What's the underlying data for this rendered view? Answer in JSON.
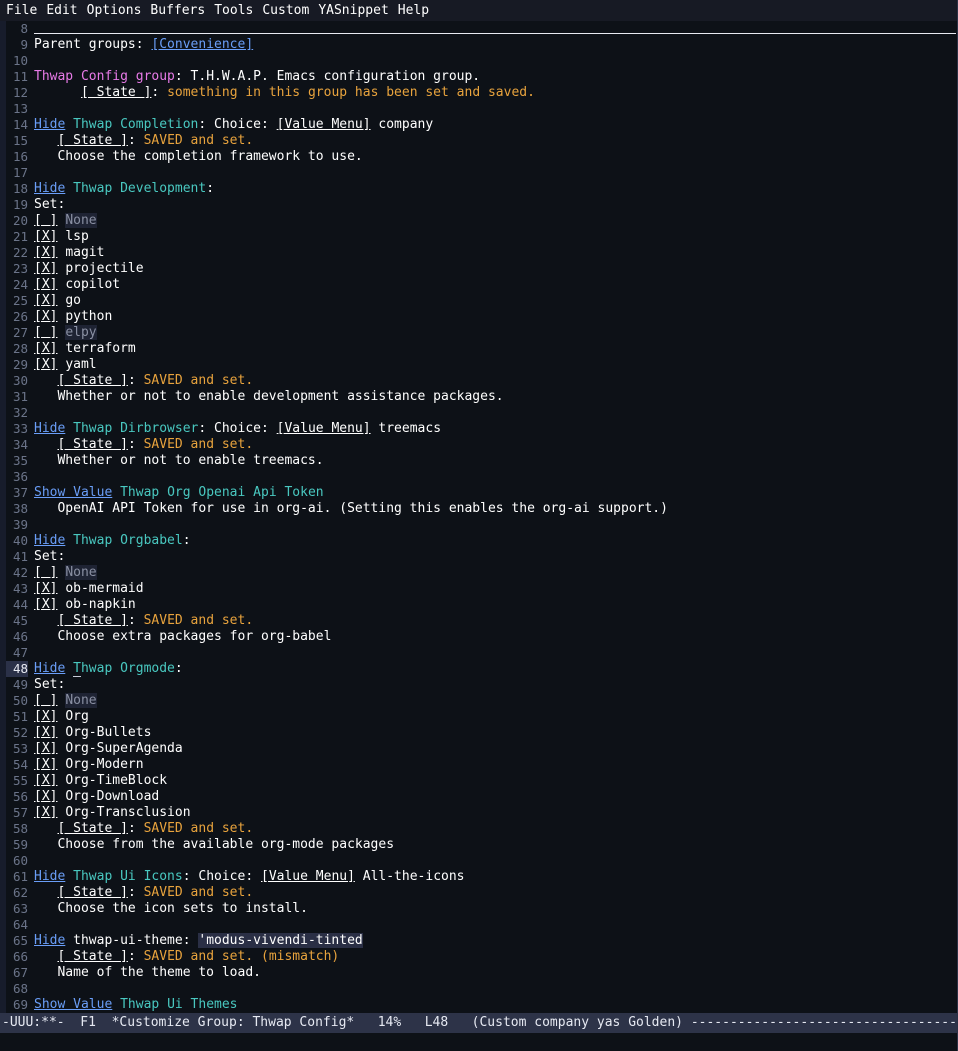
{
  "menubar": {
    "items": [
      "File",
      "Edit",
      "Options",
      "Buffers",
      "Tools",
      "Custom",
      "YASnippet",
      "Help"
    ]
  },
  "buffer": {
    "first_line_number": 8,
    "current_line_number": 48,
    "lines": [
      {
        "n": 8,
        "kind": "rule",
        "text": ""
      },
      {
        "n": 9,
        "kind": "parent",
        "label": "Parent groups: ",
        "link": "[Convenience]"
      },
      {
        "n": 10,
        "kind": "blank",
        "text": ""
      },
      {
        "n": 11,
        "kind": "grouphead",
        "group": "Thwap Config group",
        "sep": ": ",
        "desc": "T.H.W.A.P. Emacs configuration group."
      },
      {
        "n": 12,
        "kind": "state",
        "indent": "      ",
        "button": "[ State ]",
        "sep": ": ",
        "status": "something in this group has been set and saved."
      },
      {
        "n": 13,
        "kind": "blank",
        "text": ""
      },
      {
        "n": 14,
        "kind": "choice",
        "toggle": "Hide",
        "var": "Thwap Completion",
        "sep": ": Choice: ",
        "menu": "[Value Menu]",
        "value": " company"
      },
      {
        "n": 15,
        "kind": "state",
        "indent": "   ",
        "button": "[ State ]",
        "sep": ": ",
        "status": "SAVED and set."
      },
      {
        "n": 16,
        "kind": "doc",
        "text": "   Choose the completion framework to use."
      },
      {
        "n": 17,
        "kind": "blank",
        "text": ""
      },
      {
        "n": 18,
        "kind": "choice",
        "toggle": "Hide",
        "var": "Thwap Development",
        "sep": ":",
        "menu": "",
        "value": ""
      },
      {
        "n": 19,
        "kind": "doc",
        "text": "Set:"
      },
      {
        "n": 20,
        "kind": "check",
        "box": "[ ]",
        "label": "None",
        "on": false
      },
      {
        "n": 21,
        "kind": "check",
        "box": "[X]",
        "label": "lsp",
        "on": true
      },
      {
        "n": 22,
        "kind": "check",
        "box": "[X]",
        "label": "magit",
        "on": true
      },
      {
        "n": 23,
        "kind": "check",
        "box": "[X]",
        "label": "projectile",
        "on": true
      },
      {
        "n": 24,
        "kind": "check",
        "box": "[X]",
        "label": "copilot",
        "on": true
      },
      {
        "n": 25,
        "kind": "check",
        "box": "[X]",
        "label": "go",
        "on": true
      },
      {
        "n": 26,
        "kind": "check",
        "box": "[X]",
        "label": "python",
        "on": true
      },
      {
        "n": 27,
        "kind": "check",
        "box": "[ ]",
        "label": "elpy",
        "on": false
      },
      {
        "n": 28,
        "kind": "check",
        "box": "[X]",
        "label": "terraform",
        "on": true
      },
      {
        "n": 29,
        "kind": "check",
        "box": "[X]",
        "label": "yaml",
        "on": true
      },
      {
        "n": 30,
        "kind": "state",
        "indent": "   ",
        "button": "[ State ]",
        "sep": ": ",
        "status": "SAVED and set."
      },
      {
        "n": 31,
        "kind": "doc",
        "text": "   Whether or not to enable development assistance packages."
      },
      {
        "n": 32,
        "kind": "blank",
        "text": ""
      },
      {
        "n": 33,
        "kind": "choice",
        "toggle": "Hide",
        "var": "Thwap Dirbrowser",
        "sep": ": Choice: ",
        "menu": "[Value Menu]",
        "value": " treemacs"
      },
      {
        "n": 34,
        "kind": "state",
        "indent": "   ",
        "button": "[ State ]",
        "sep": ": ",
        "status": "SAVED and set."
      },
      {
        "n": 35,
        "kind": "doc",
        "text": "   Whether or not to enable treemacs."
      },
      {
        "n": 36,
        "kind": "blank",
        "text": ""
      },
      {
        "n": 37,
        "kind": "choice",
        "toggle": "Show Value",
        "var": "Thwap Org Openai Api Token",
        "sep": "",
        "menu": "",
        "value": ""
      },
      {
        "n": 38,
        "kind": "doc",
        "text": "   OpenAI API Token for use in org-ai. (Setting this enables the org-ai support.)"
      },
      {
        "n": 39,
        "kind": "blank",
        "text": ""
      },
      {
        "n": 40,
        "kind": "choice",
        "toggle": "Hide",
        "var": "Thwap Orgbabel",
        "sep": ":",
        "menu": "",
        "value": ""
      },
      {
        "n": 41,
        "kind": "doc",
        "text": "Set:"
      },
      {
        "n": 42,
        "kind": "check",
        "box": "[ ]",
        "label": "None",
        "on": false
      },
      {
        "n": 43,
        "kind": "check",
        "box": "[X]",
        "label": "ob-mermaid",
        "on": true
      },
      {
        "n": 44,
        "kind": "check",
        "box": "[X]",
        "label": "ob-napkin",
        "on": true
      },
      {
        "n": 45,
        "kind": "state",
        "indent": "   ",
        "button": "[ State ]",
        "sep": ": ",
        "status": "SAVED and set."
      },
      {
        "n": 46,
        "kind": "doc",
        "text": "   Choose extra packages for org-babel"
      },
      {
        "n": 47,
        "kind": "blank",
        "text": ""
      },
      {
        "n": 48,
        "kind": "choice",
        "toggle": "Hide",
        "var": "Thwap Orgmode",
        "sep": ":",
        "menu": "",
        "value": "",
        "cursor": true
      },
      {
        "n": 49,
        "kind": "doc",
        "text": "Set:"
      },
      {
        "n": 50,
        "kind": "check",
        "box": "[ ]",
        "label": "None",
        "on": false
      },
      {
        "n": 51,
        "kind": "check",
        "box": "[X]",
        "label": "Org",
        "on": true
      },
      {
        "n": 52,
        "kind": "check",
        "box": "[X]",
        "label": "Org-Bullets",
        "on": true
      },
      {
        "n": 53,
        "kind": "check",
        "box": "[X]",
        "label": "Org-SuperAgenda",
        "on": true
      },
      {
        "n": 54,
        "kind": "check",
        "box": "[X]",
        "label": "Org-Modern",
        "on": true
      },
      {
        "n": 55,
        "kind": "check",
        "box": "[X]",
        "label": "Org-TimeBlock",
        "on": true
      },
      {
        "n": 56,
        "kind": "check",
        "box": "[X]",
        "label": "Org-Download",
        "on": true
      },
      {
        "n": 57,
        "kind": "check",
        "box": "[X]",
        "label": "Org-Transclusion",
        "on": true
      },
      {
        "n": 58,
        "kind": "state",
        "indent": "   ",
        "button": "[ State ]",
        "sep": ": ",
        "status": "SAVED and set."
      },
      {
        "n": 59,
        "kind": "doc",
        "text": "   Choose from the available org-mode packages"
      },
      {
        "n": 60,
        "kind": "blank",
        "text": ""
      },
      {
        "n": 61,
        "kind": "choice",
        "toggle": "Hide",
        "var": "Thwap Ui Icons",
        "sep": ": Choice: ",
        "menu": "[Value Menu]",
        "value": " All-the-icons"
      },
      {
        "n": 62,
        "kind": "state",
        "indent": "   ",
        "button": "[ State ]",
        "sep": ": ",
        "status": "SAVED and set."
      },
      {
        "n": 63,
        "kind": "doc",
        "text": "   Choose the icon sets to install."
      },
      {
        "n": 64,
        "kind": "blank",
        "text": ""
      },
      {
        "n": 65,
        "kind": "fieldline",
        "toggle": "Hide",
        "name": " thwap-ui-theme: ",
        "field": "'modus-vivendi-tinted"
      },
      {
        "n": 66,
        "kind": "state",
        "indent": "   ",
        "button": "[ State ]",
        "sep": ": ",
        "status": "SAVED and set. (mismatch)"
      },
      {
        "n": 67,
        "kind": "doc",
        "text": "   Name of the theme to load."
      },
      {
        "n": 68,
        "kind": "blank",
        "text": ""
      },
      {
        "n": 69,
        "kind": "choice",
        "toggle": "Show Value",
        "var": "Thwap Ui Themes",
        "sep": "",
        "menu": "",
        "value": ""
      }
    ]
  },
  "modeline": {
    "indicators": "-UUU:**-",
    "frame": "F1",
    "buffer_name": "*Customize Group: Thwap Config*",
    "percent": "14%",
    "line_pos": "L48",
    "modes": "(Custom company yas Golden)",
    "filler": "-----------------------------------------------------------------------------------------------------------"
  },
  "colors": {
    "background": "#0d1117",
    "foreground": "#ffffff",
    "link": "#6a9ef8",
    "group_head": "#e87be8",
    "variable": "#49c8c0",
    "state": "#e8a33d",
    "line_number": "#6b7489",
    "modeline_bg": "#2d3348",
    "field_bg": "#2a2f45",
    "dim": "#8a90a3"
  }
}
